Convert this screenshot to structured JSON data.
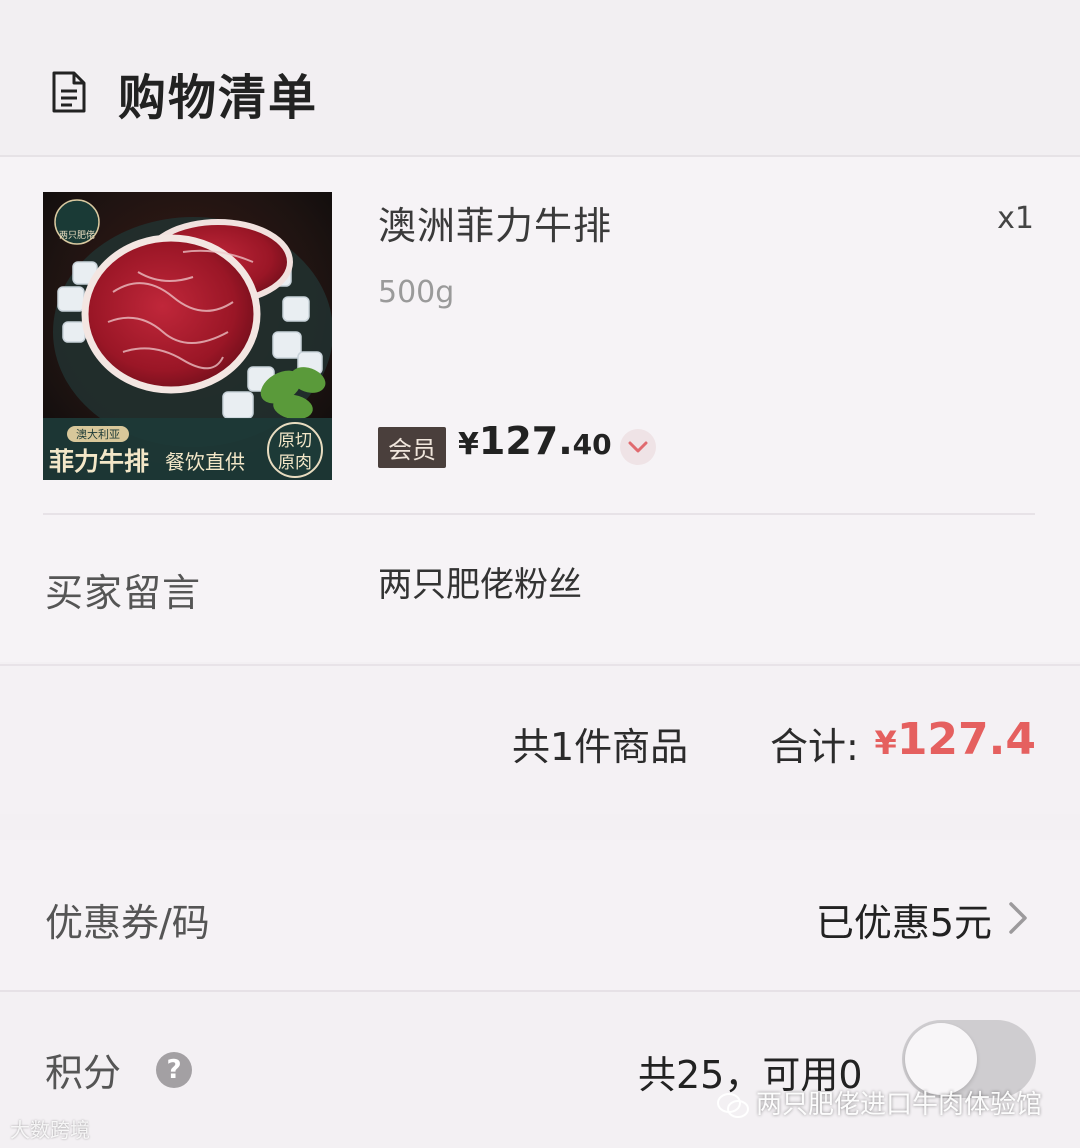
{
  "header": {
    "title": "购物清单",
    "icon": "document-icon"
  },
  "product": {
    "name": "澳洲菲力牛排",
    "quantity": "x1",
    "spec": "500g",
    "member_badge": "会员",
    "price_symbol": "¥",
    "price_int": "127.",
    "price_dec": "40",
    "image_texts": {
      "brand": "两只肥佬",
      "origin": "澳大利亚",
      "name": "菲力牛排",
      "slogan": "餐饮直供",
      "stamp_line1": "原切",
      "stamp_line2": "原肉"
    }
  },
  "buyer_message": {
    "label": "买家留言",
    "value": "两只肥佬粉丝"
  },
  "summary": {
    "count": "共1件商品",
    "total_label": "合计:",
    "total_symbol": "¥",
    "total_value": "127.4"
  },
  "coupon": {
    "label": "优惠券/码",
    "value": "已优惠5元"
  },
  "points": {
    "label": "积分",
    "help": "?",
    "value": "共25，可用0",
    "toggle_on": false
  },
  "watermarks": {
    "left": "大数跨境",
    "right": "两只肥佬进口牛肉体验馆"
  },
  "colors": {
    "accent_red": "#e5605f",
    "badge_bg": "#4a3f3c"
  }
}
